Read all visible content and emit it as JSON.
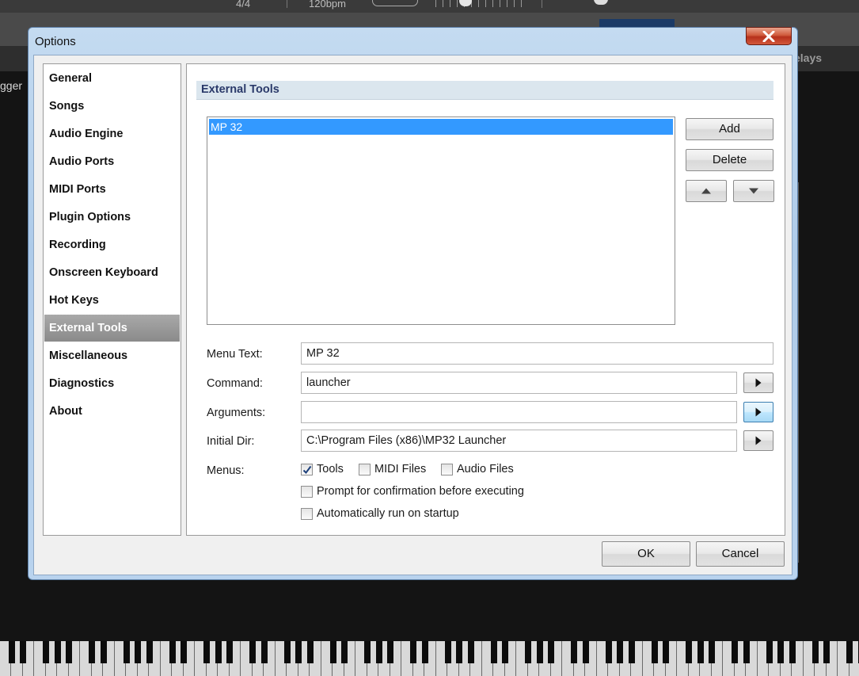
{
  "background": {
    "top_readout_signature": "4/4",
    "top_readout_tempo": "120bpm",
    "trigger_fragment": "gger",
    "delays_fragment": "elays"
  },
  "dialog": {
    "title": "Options",
    "close_icon": "close-icon"
  },
  "sidebar": {
    "items": [
      {
        "label": "General"
      },
      {
        "label": "Songs"
      },
      {
        "label": "Audio Engine"
      },
      {
        "label": "Audio Ports"
      },
      {
        "label": "MIDI Ports"
      },
      {
        "label": "Plugin Options"
      },
      {
        "label": "Recording"
      },
      {
        "label": "Onscreen Keyboard"
      },
      {
        "label": "Hot Keys"
      },
      {
        "label": "External Tools"
      },
      {
        "label": "Miscellaneous"
      },
      {
        "label": "Diagnostics"
      },
      {
        "label": "About"
      }
    ],
    "active_index": 9
  },
  "panel": {
    "header": "External Tools",
    "tools": [
      {
        "name": "MP 32",
        "selected": true
      }
    ],
    "buttons": {
      "add": "Add",
      "delete": "Delete",
      "move_up_icon": "triangle-up-icon",
      "move_down_icon": "triangle-down-icon"
    },
    "fields": {
      "menu_text": {
        "label": "Menu Text:",
        "value": "MP 32"
      },
      "command": {
        "label": "Command:",
        "value": "launcher"
      },
      "arguments": {
        "label": "Arguments:",
        "value": ""
      },
      "initial_dir": {
        "label": "Initial Dir:",
        "value": "C:\\Program Files (x86)\\MP32 Launcher"
      }
    },
    "menus": {
      "label": "Menus:",
      "options": [
        {
          "label": "Tools",
          "checked": true
        },
        {
          "label": "MIDI Files",
          "checked": false
        },
        {
          "label": "Audio Files",
          "checked": false
        }
      ]
    },
    "prompt_confirmation": {
      "label": "Prompt for confirmation before executing",
      "checked": false
    },
    "run_on_startup": {
      "label": "Automatically run on startup",
      "checked": false
    }
  },
  "footer": {
    "ok": "OK",
    "cancel": "Cancel"
  }
}
